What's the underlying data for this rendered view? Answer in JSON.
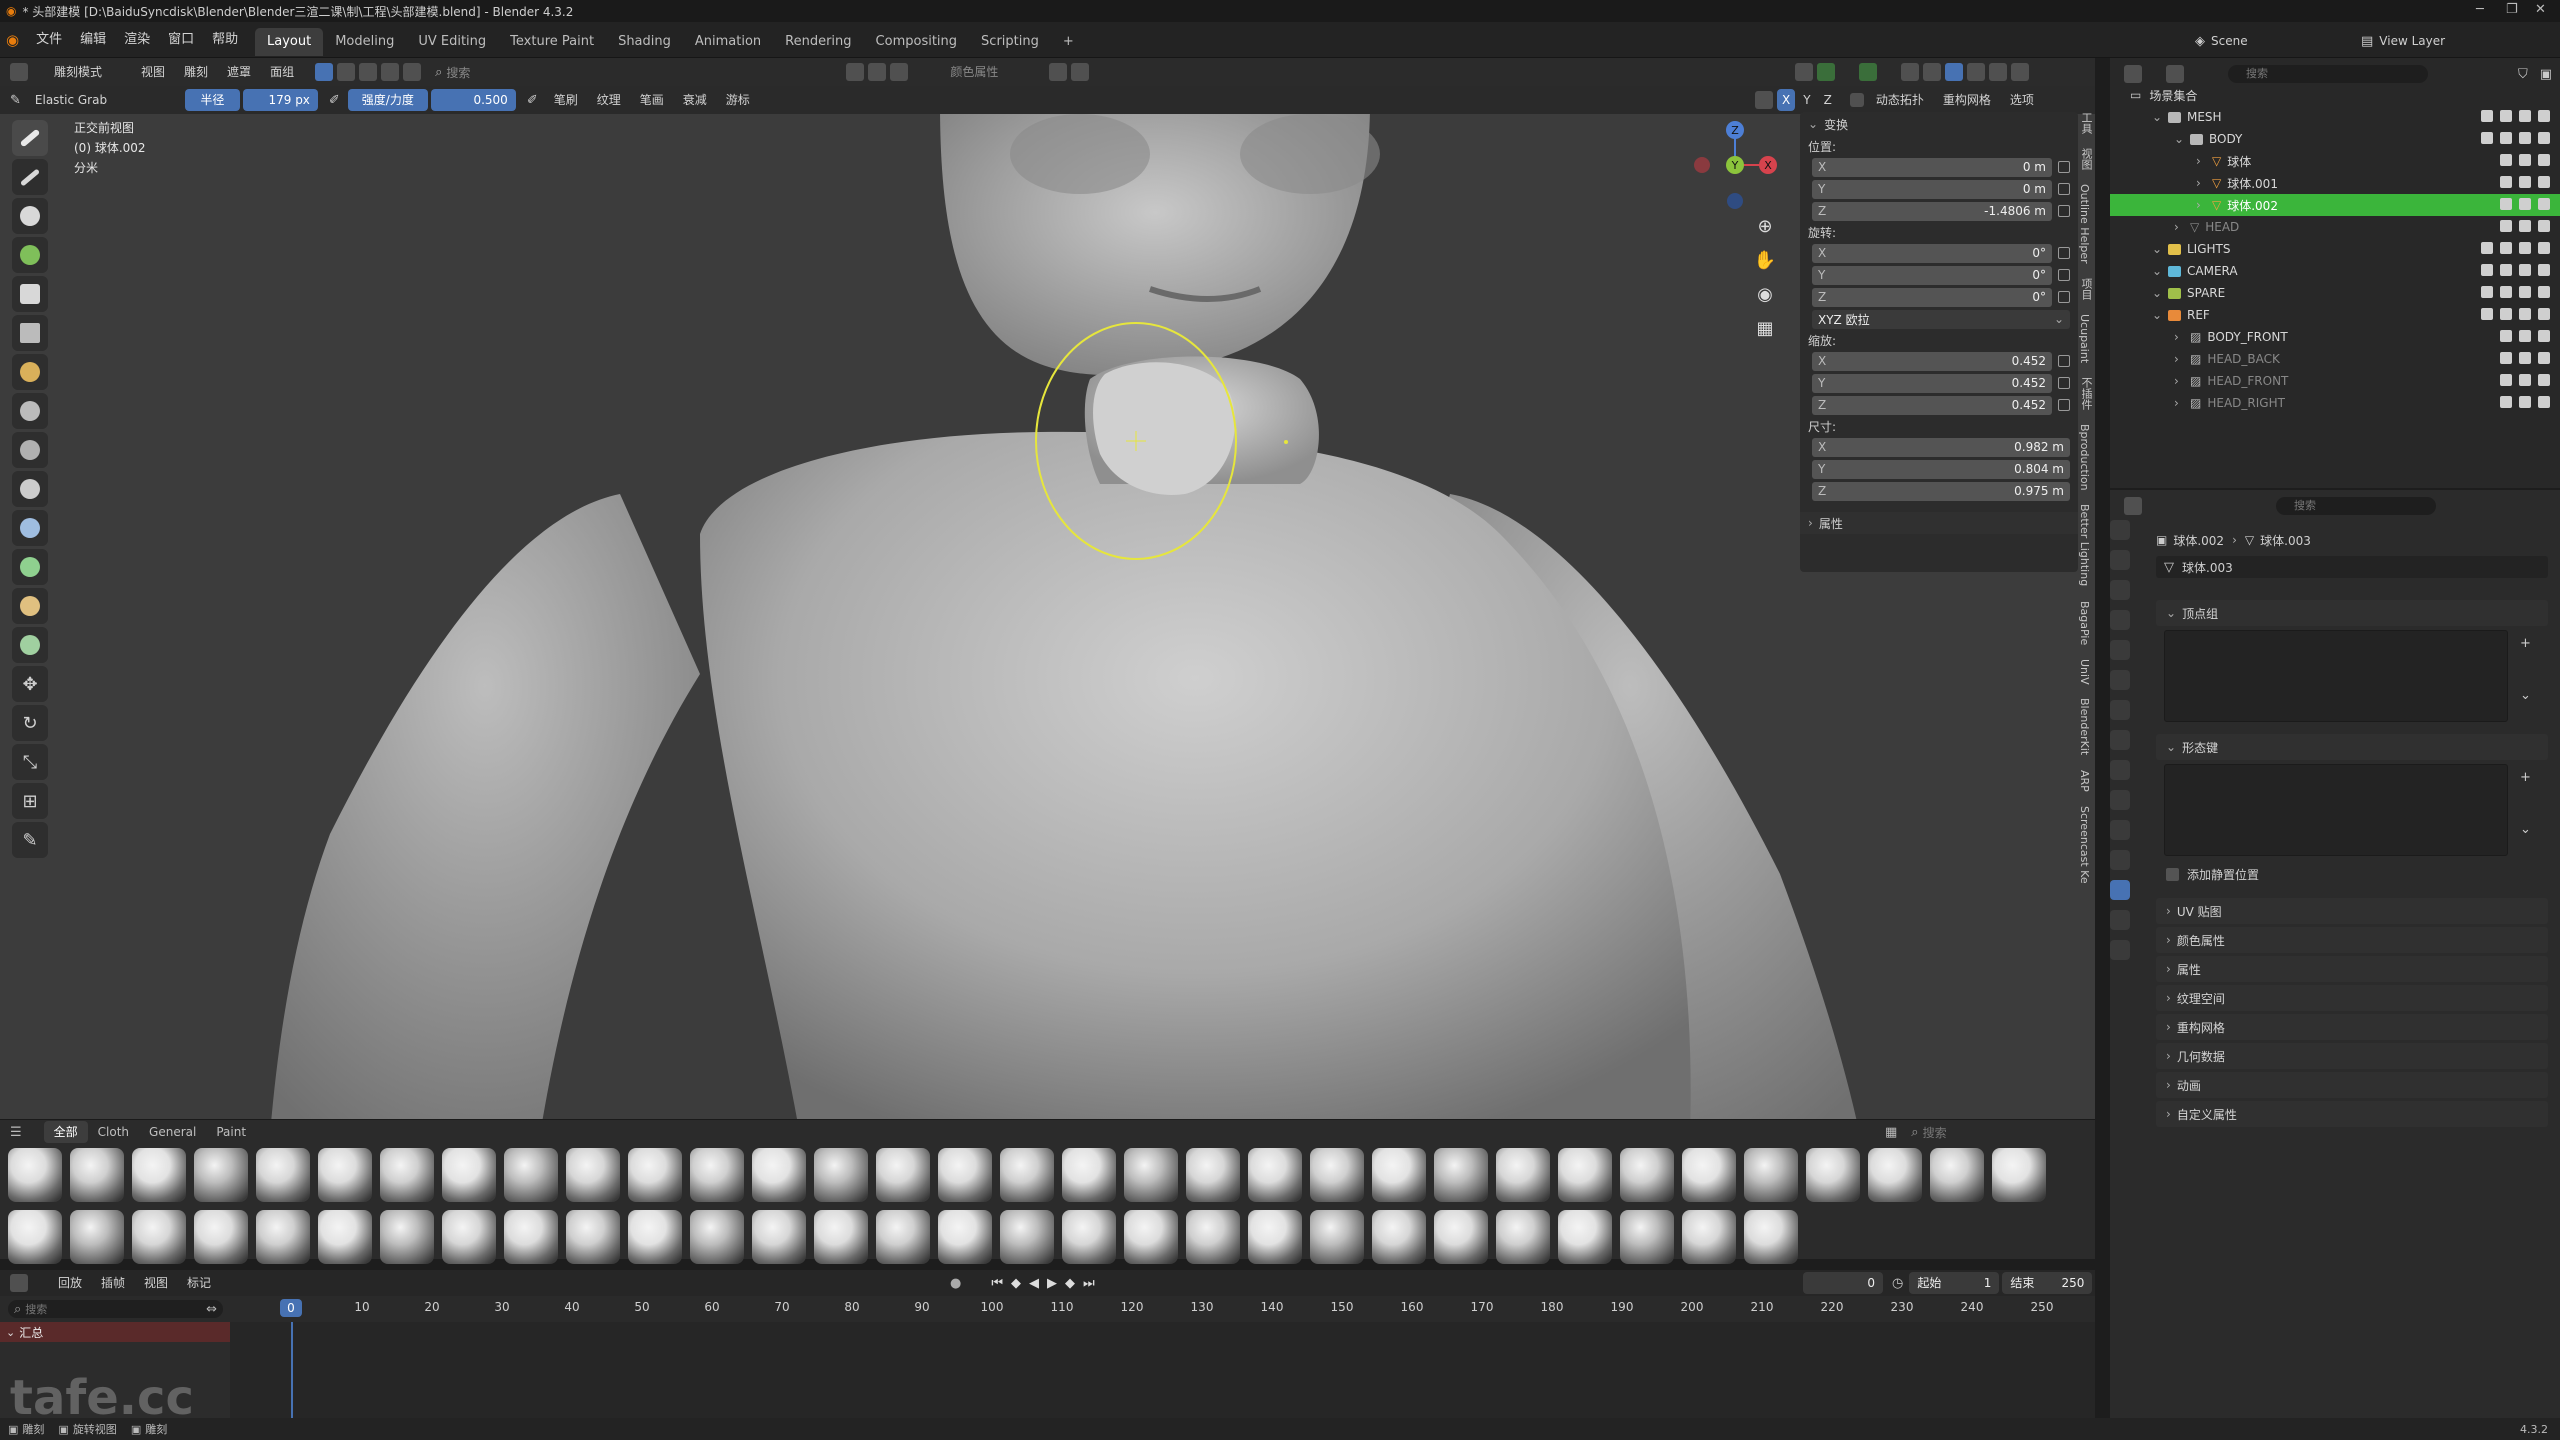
{
  "window": {
    "title": "* 头部建模 [D:\\BaiduSyncdisk\\Blender\\Blender三渲二课\\制\\工程\\头部建模.blend] - Blender 4.3.2",
    "version": "4.3.2"
  },
  "menu": [
    "文件",
    "编辑",
    "渲染",
    "窗口",
    "帮助"
  ],
  "workspaces": [
    "Layout",
    "Modeling",
    "UV Editing",
    "Texture Paint",
    "Shading",
    "Animation",
    "Rendering",
    "Compositing",
    "Scripting"
  ],
  "active_workspace": "Layout",
  "top_right": {
    "scene_label": "Scene",
    "view_layer_label": "View Layer"
  },
  "viewport_header": {
    "mode": "雕刻模式",
    "menus": [
      "视图",
      "雕刻",
      "遮罩",
      "面组"
    ],
    "search_placeholder": "搜索",
    "color_attr": "颜色属性",
    "dyntopo": "动态拓扑",
    "remesh": "重构网格",
    "options": "选项",
    "axis_x": "X",
    "axis_y": "Y",
    "axis_z": "Z"
  },
  "tool_header": {
    "brush_name": "Elastic Grab",
    "radius_label": "半径",
    "radius_value": "179 px",
    "strength_label": "强度/力度",
    "strength_value": "0.500",
    "menus": [
      "笔刷",
      "纹理",
      "笔画",
      "衰减",
      "游标"
    ]
  },
  "viewport_info": {
    "line1": "正交前视图",
    "line2": "(0) 球体.002",
    "line3": "分米"
  },
  "transform_panel": {
    "header": "变换",
    "location_label": "位置:",
    "location": [
      {
        "axis": "X",
        "value": "0 m"
      },
      {
        "axis": "Y",
        "value": "0 m"
      },
      {
        "axis": "Z",
        "value": "-1.4806 m"
      }
    ],
    "rotation_label": "旋转:",
    "rotation": [
      {
        "axis": "X",
        "value": "0°"
      },
      {
        "axis": "Y",
        "value": "0°"
      },
      {
        "axis": "Z",
        "value": "0°"
      }
    ],
    "rotation_mode": "XYZ 欧拉",
    "scale_label": "缩放:",
    "scale": [
      {
        "axis": "X",
        "value": "0.452"
      },
      {
        "axis": "Y",
        "value": "0.452"
      },
      {
        "axis": "Z",
        "value": "0.452"
      }
    ],
    "dimensions_label": "尺寸:",
    "dimensions": [
      {
        "axis": "X",
        "value": "0.982 m"
      },
      {
        "axis": "Y",
        "value": "0.804 m"
      },
      {
        "axis": "Z",
        "value": "0.975 m"
      }
    ],
    "properties_label": "属性"
  },
  "sidebar_tabs": [
    "工具",
    "视图",
    "Outline Helper",
    "项目",
    "Ucupaint",
    "不插件",
    "Bproduction",
    "Better Lighting",
    "BagaPie",
    "UniV",
    "BlenderKit",
    "ARP",
    "Screencast Ke"
  ],
  "shelf": {
    "tabs": [
      "全部",
      "Cloth",
      "General",
      "Paint"
    ],
    "active": "全部",
    "search_placeholder": "搜索"
  },
  "timeline": {
    "menus": [
      "回放",
      "插帧",
      "视图",
      "标记"
    ],
    "current_frame": "0",
    "start_label": "起始",
    "start": "1",
    "end_label": "结束",
    "end": "250",
    "frame_box": "0",
    "ticks": [
      "0",
      "10",
      "20",
      "30",
      "40",
      "50",
      "60",
      "70",
      "80",
      "90",
      "100",
      "110",
      "120",
      "130",
      "140",
      "150",
      "160",
      "170",
      "180",
      "190",
      "200",
      "210",
      "220",
      "230",
      "240",
      "250"
    ],
    "search_placeholder": "搜索",
    "summary": "汇总"
  },
  "watermark": "tafe.cc",
  "outliner": {
    "search_placeholder": "搜索",
    "root": "场景集合",
    "rows": [
      {
        "name": "MESH",
        "indent": 1,
        "kind": "collection",
        "color": "#b8b8b8"
      },
      {
        "name": "BODY",
        "indent": 2,
        "kind": "collection",
        "color": "#b8b8b8"
      },
      {
        "name": "球体",
        "indent": 3,
        "kind": "mesh"
      },
      {
        "name": "球体.001",
        "indent": 3,
        "kind": "mesh"
      },
      {
        "name": "球体.002",
        "indent": 3,
        "kind": "mesh",
        "selected": true
      },
      {
        "name": "HEAD",
        "indent": 2,
        "kind": "object",
        "dim": true
      },
      {
        "name": "LIGHTS",
        "indent": 1,
        "kind": "collection",
        "color": "#e2c04a"
      },
      {
        "name": "CAMERA",
        "indent": 1,
        "kind": "collection",
        "color": "#5fb8d9"
      },
      {
        "name": "SPARE",
        "indent": 1,
        "kind": "collection",
        "color": "#a0c04a"
      },
      {
        "name": "REF",
        "indent": 1,
        "kind": "collection",
        "color": "#e88a3a"
      },
      {
        "name": "BODY_FRONT",
        "indent": 2,
        "kind": "image"
      },
      {
        "name": "HEAD_BACK",
        "indent": 2,
        "kind": "image",
        "dim": true
      },
      {
        "name": "HEAD_FRONT",
        "indent": 2,
        "kind": "image",
        "dim": true
      },
      {
        "name": "HEAD_RIGHT",
        "indent": 2,
        "kind": "image",
        "dim": true
      }
    ]
  },
  "properties": {
    "search_placeholder": "搜索",
    "breadcrumb_object": "球体.002",
    "breadcrumb_data": "球体.003",
    "datablock": "球体.003",
    "vertex_groups": "顶点组",
    "shape_keys": "形态键",
    "add_rest_position": "添加静置位置",
    "sections": [
      "UV 贴图",
      "颜色属性",
      "属性",
      "纹理空间",
      "重构网格",
      "几何数据",
      "动画",
      "自定义属性"
    ]
  },
  "statusbar": {
    "left": [
      "雕刻",
      "旋转视图",
      "雕刻"
    ],
    "version": "4.3.2"
  }
}
